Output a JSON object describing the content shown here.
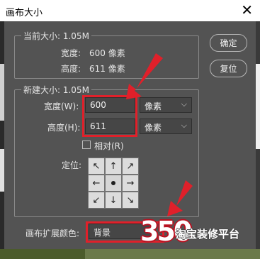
{
  "window": {
    "title": "画布大小",
    "close_glyph": "✕"
  },
  "current_size": {
    "heading": "当前大小: 1.05M",
    "width_label": "宽度:",
    "width_value": "600 像素",
    "height_label": "高度:",
    "height_value": "611 像素"
  },
  "new_size": {
    "heading": "新建大小: 1.05M",
    "width_label": "宽度(W):",
    "width_value": "600",
    "width_unit": "像素",
    "height_label": "高度(H):",
    "height_value": "611",
    "height_unit": "像素",
    "relative_label": "相对(R)",
    "relative_checked": false,
    "anchor_label": "定位:",
    "anchor_glyphs": [
      "↖",
      "↑",
      "↗",
      "←",
      "•",
      "→",
      "↙",
      "↓",
      "↘"
    ]
  },
  "extension_color": {
    "label": "画布扩展颜色:",
    "value": "背景"
  },
  "buttons": {
    "ok": "确定",
    "reset": "复位"
  },
  "watermark": {
    "logo": "350",
    "text": "淘宝装修平台"
  },
  "colors": {
    "dialog_bg": "#535353",
    "highlight": "#e0202a"
  }
}
